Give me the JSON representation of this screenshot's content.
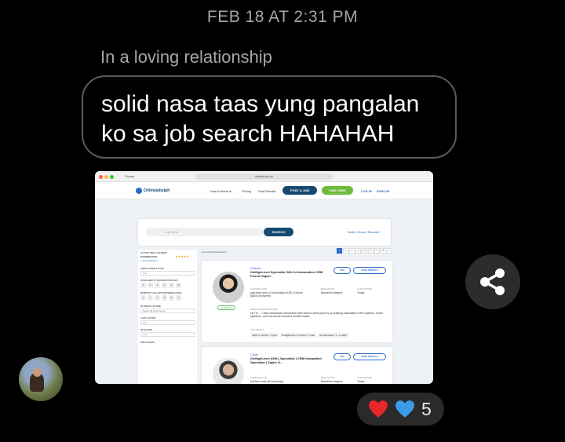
{
  "timestamp": "FEB 18 AT 2:31 PM",
  "reply_context": "In a loving relationship",
  "message": {
    "line1": "solid nasa taas yung pangalan",
    "line2": "ko sa job search HAHAHAH"
  },
  "screenshot": {
    "tab_label": "Private",
    "url": "onlinejobs.ph",
    "logo_text": "Onlinejobs|ph",
    "nav": {
      "how_it_works": "How it Works ▾",
      "pricing": "Pricing",
      "paid_results": "Paid Results",
      "post_job": "POST A JOB",
      "find_jobs": "FIND JOBS",
      "login": "LOG IN",
      "signup": "SIGN UP"
    },
    "search": {
      "placeholder": "e.g. GHL",
      "button": "SEARCH",
      "better": "Better Search Results?"
    },
    "filters": {
      "active_title": "ACTIVE SKILL FILTERS",
      "active_skill": "GOHIGHLEVEL",
      "add_skill": "+ Add skill filters",
      "employment_type": "EMPLOYMENT TYPE",
      "employment_value": "Any",
      "availability": "AVAILABILITY (HOURS PER DAY)",
      "availability_values": [
        "0",
        "2",
        "4",
        "6",
        "8",
        "10"
      ],
      "salary": "MONTHLY SALARY BETWEEN (USD)",
      "salary_values": [
        "$",
        "4",
        "0",
        "$",
        "M",
        "0"
      ],
      "id_proof": "ID PROOF SCORE",
      "id_proof_value": "Select ID Proof Score",
      "last_active": "LAST ACTIVE",
      "last_active_value": "Any",
      "iq_score": "IQ SCORE",
      "iq_value": "Any",
      "education": "EDUCATION"
    },
    "results": {
      "found": "Found 2204 jobseekers",
      "pages": [
        "1",
        "2",
        "3",
        "4",
        "5",
        "6",
        "7",
        "8",
        "»"
      ],
      "cards": [
        {
          "name": "Charles",
          "title": "GoHighLevel Specialist GHL AI Automation CRM Funnel Zapier",
          "pin": "PIN",
          "view": "VIEW PROFILE",
          "looking_for_label": "LOOKING FOR",
          "looking_for": "part-time work (4 hours/day) at $10.11/hour ($505.00/month)",
          "education_label": "EDUCATION",
          "education": "Bachelors degree",
          "last_active_label": "LAST ACTIVE",
          "last_active": "Today",
          "desc_label": "PROFILE DESCRIPTION",
          "desc": "Hi! I'm ... I help businesses streamline their lead-to-client journey by building automated CRM systems, smart pipelines, and conversion-focused funnels inside...",
          "badge": "ID PROOF",
          "skills_label": "TOP SKILLS",
          "skills": [
            "CRM: 6 months - 1 year",
            "GoHighLevel: 6 months - 1 year",
            "AI Automation: 1 - 2 years"
          ]
        },
        {
          "name": "Clyde",
          "title": "GoHighLevel (GHL) Specialist | CRM Integration Specialist | Zapier &...",
          "pin": "PIN",
          "view": "VIEW PROFILE",
          "looking_for_label": "LOOKING FOR",
          "looking_for": "full-time work (8 hours/day)",
          "education_label": "EDUCATION",
          "education": "Bachelors degree",
          "last_active_label": "LAST ACTIVE",
          "last_active": "Today"
        }
      ]
    }
  },
  "reactions": {
    "count": "5"
  },
  "colors": {
    "accent_blue": "#2a6ac8",
    "navy": "#164a72",
    "green": "#5cb85c",
    "heart_red": "#e8272b",
    "heart_blue": "#3b9be8"
  }
}
